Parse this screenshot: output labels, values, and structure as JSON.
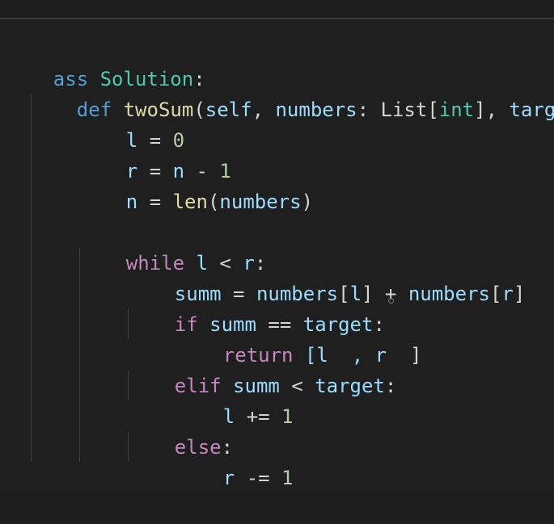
{
  "top_partial": "",
  "code": {
    "line1": {
      "kw": "ass",
      "name": "Solution",
      "tail": ":"
    },
    "line2": {
      "kw": "def",
      "name": "twoSum",
      "p1": "(",
      "self": "self",
      "c1": ", ",
      "numbers": "numbers",
      "c2": ": ",
      "list_type": "List",
      "b1": "[",
      "int": "int",
      "b2": "]",
      "c3": ", ",
      "target": "target"
    },
    "line3": {
      "a": "l",
      "b": " = ",
      "c": "0"
    },
    "line4": {
      "a": "r",
      "b": " = ",
      "c": "n",
      "d": " - ",
      "e": "1"
    },
    "line5": {
      "a": "n",
      "b": " = ",
      "c": "len",
      "d": "(",
      "e": "numbers",
      "f": ")"
    },
    "line6": {
      "kw": "while",
      "a": " l ",
      "b": "<",
      "c": " r",
      "d": ":"
    },
    "line7": {
      "a": "summ",
      "b": " = ",
      "c": "numbers",
      "d": "[",
      "e": "l",
      "f": "] + ",
      "g": "numbers",
      "h": "[",
      "i": "r",
      "j": "]"
    },
    "line8": {
      "kw": "if",
      "a": " summ ",
      "b": "==",
      "c": " target",
      "d": ":"
    },
    "line9": {
      "kw": "return",
      "a": " [l",
      "b": "  , r",
      "c": "  ]"
    },
    "line10": {
      "kw": "elif",
      "a": " summ ",
      "b": "<",
      "c": " target",
      "d": ":"
    },
    "line11": {
      "a": "l",
      "b": " += ",
      "c": "1"
    },
    "line12": {
      "kw": "else",
      "d": ":"
    },
    "line13": {
      "a": "r",
      "b": " -= ",
      "c": "1"
    }
  }
}
